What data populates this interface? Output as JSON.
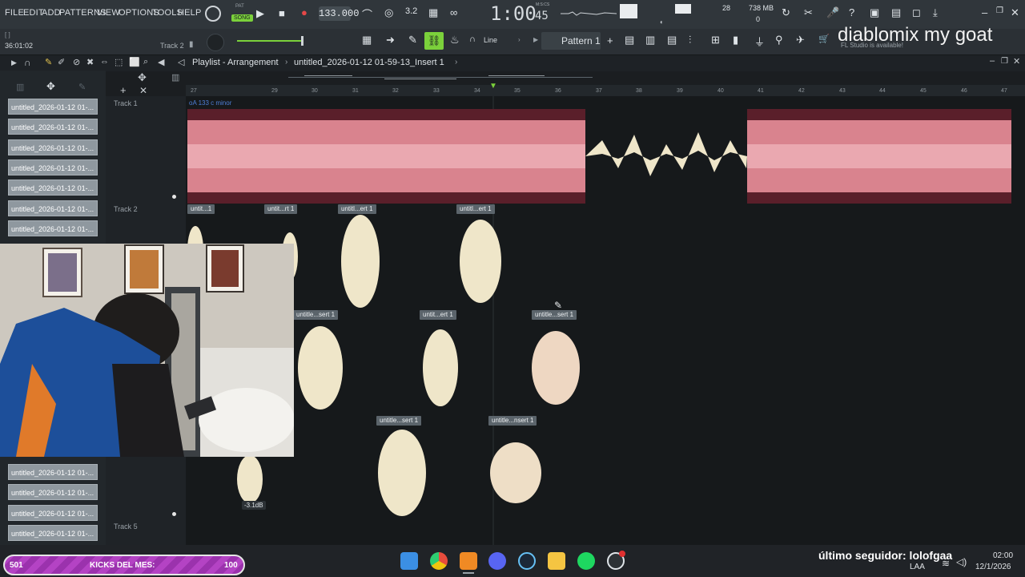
{
  "menu": [
    "FILE",
    "EDIT",
    "ADD",
    "PATTERNS",
    "VIEW",
    "OPTIONS",
    "TOOLS",
    "HELP"
  ],
  "transport": {
    "pat_label": "PAT",
    "song_label": "SONG",
    "bpm": "133.000",
    "time_main": "1:00",
    "time_sub": "45",
    "time_unit": "M:S:CS",
    "cpu_value": "28",
    "memory": "738 MB",
    "memory_sub": "0"
  },
  "hint": {
    "position": "36:01:02",
    "track": "Track 2",
    "brackets": "[  ]"
  },
  "toolbar2": {
    "snap_mode": "Line",
    "pattern": "Pattern 1",
    "plus": "+",
    "update_notice": "FL Studio is available!"
  },
  "playlist": {
    "title": "Playlist - Arrangement",
    "file": "untitled_2026-01-12 01-59-13_Insert 1",
    "tempo_marker": "oA 133 c minor"
  },
  "ruler": [
    "27",
    "29",
    "30",
    "31",
    "32",
    "33",
    "34",
    "35",
    "36",
    "37",
    "38",
    "39",
    "40",
    "41",
    "42",
    "43",
    "44",
    "45",
    "46",
    "47"
  ],
  "picker_items": [
    "untitled_2026-01-12 01-...",
    "untitled_2026-01-12 01-...",
    "untitled_2026-01-12 01-...",
    "untitled_2026-01-12 01-...",
    "untitled_2026-01-12 01-...",
    "untitled_2026-01-12 01-...",
    "untitled_2026-01-12 01-...",
    "untitled_2026-01-12 01-...",
    "untitled_2026-01-12 01-...",
    "untitled_2026-01-12 01-...",
    "untitled_2026-01-12 01-..."
  ],
  "tracks": {
    "t1": "Track 1",
    "t2": "Track 2",
    "t5": "Track 5"
  },
  "clips": {
    "c1": "untit...1",
    "c2": "untit...rt 1",
    "c3": "untitl...ert 1",
    "c4": "untitl...ert 1",
    "c5": "untitle...sert 1",
    "c6": "untit...ert 1",
    "c7": "untitle...sert 1",
    "c8": "untitle...sert 1",
    "c9": "untitle...nsert 1"
  },
  "clip_volume": "-3.1dB",
  "overlay": {
    "title": "diablomix my goat",
    "follower": "último seguidor: lolofgaa"
  },
  "kicks": {
    "left": "501",
    "label": "KICKS DEL MES:",
    "right": "100"
  },
  "system": {
    "lang": "LAA",
    "time": "02:00",
    "date": "12/1/2026"
  },
  "colors": {
    "accent_green": "#7bd13b",
    "clip_red": "#d9838e",
    "clip_cream": "#efe6c9",
    "kicks_purple": "#b443c4"
  }
}
